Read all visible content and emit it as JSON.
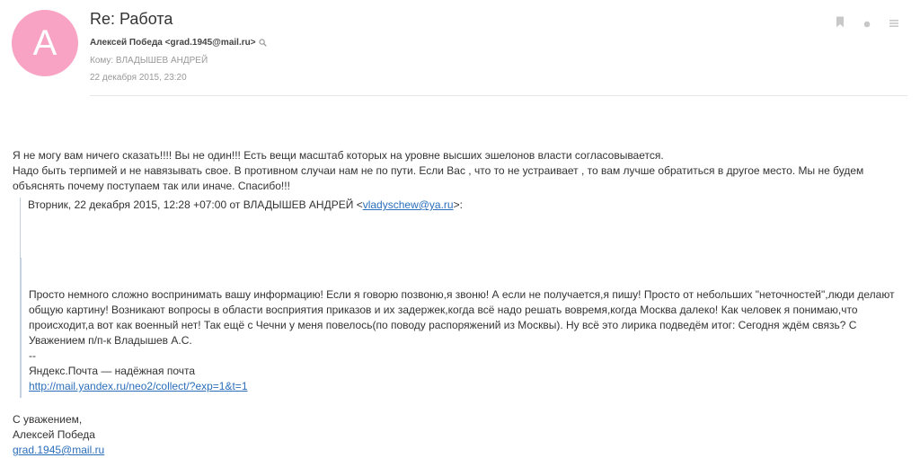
{
  "avatar": {
    "letter": "A",
    "color": "#f8a3c3"
  },
  "header": {
    "subject": "Re: Работа",
    "sender": "Алексей Победа <grad.1945@mail.ru>",
    "recipient": "Кому: ВЛАДЫШЕВ АНДРЕЙ",
    "date": "22 декабря 2015, 23:20"
  },
  "icons": {
    "sender_search": "search-icon",
    "bookmark": "bookmark-icon",
    "status_dot": "dot-icon",
    "menu": "menu-icon"
  },
  "message": {
    "line1": "Я не могу вам ничего сказать!!!! Вы не один!!! Есть вещи масштаб которых  на уровне высших эшелонов власти согласовывается.",
    "line2": "Надо быть терпимей и не навязывать свое. В противном случаи нам не по пути. Если Вас , что то не устраивает , то вам лучше обратиться в другое место. Мы не будем объяснять почему поступаем так или иначе. Спасибо!!!"
  },
  "quote": {
    "header_prefix": "Вторник, 22 декабря 2015, 12:28 +07:00 от ВЛАДЫШЕВ АНДРЕЙ <",
    "header_email": "vladyschew@ya.ru",
    "header_suffix": ">:",
    "body": "Просто немного сложно воспринимать вашу информацию! Если я говорю позвоню,я звоню! А если не получается,я пишу! Просто от небольших \"неточностей\",люди делают общую картину! Возникают вопросы в области восприятия приказов и их задержек,когда всё надо решать вовремя,когда Москва далеко! Как человек я понимаю,что происходит,а вот как военный нет! Так ещё с Чечни у меня повелось(по поводу распоряжений из Москвы). Ну всё это лирика подведём итог: Сегодня ждём связь? С Уважением п/п-к Владышев А.С.",
    "sig_separator": "--",
    "sig_text": "Яндекс.Почта — надёжная почта",
    "sig_link": "http://mail.yandex.ru/neo2/collect/?exp=1&t=1"
  },
  "signature": {
    "greeting": "С уважением,",
    "name": "Алексей Победа",
    "email": "grad.1945@mail.ru"
  },
  "colors": {
    "link": "#2a6ebb",
    "quote_border": "#c4cfe0",
    "muted": "#999999"
  }
}
